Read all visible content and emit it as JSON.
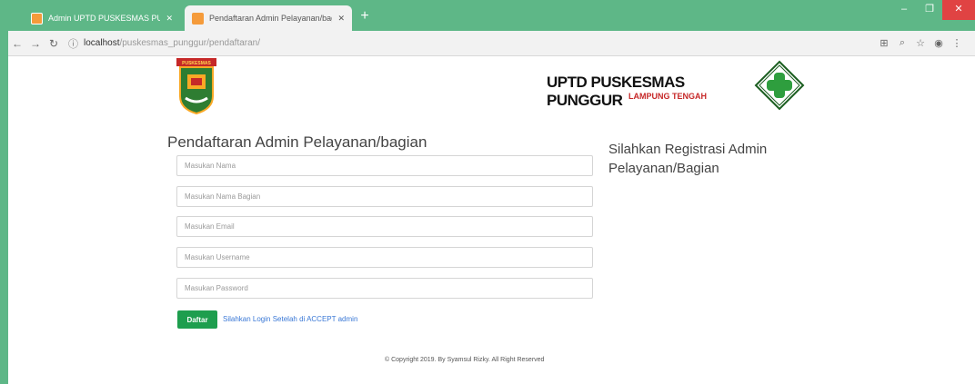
{
  "browser": {
    "tabs": [
      {
        "title": "Admin UPTD PUSKESMAS PUNGGUR",
        "active": false
      },
      {
        "title": "Pendaftaran Admin Pelayanan/bagian",
        "active": true
      }
    ],
    "url_host": "localhost",
    "url_path": "/puskesmas_punggur/pendaftaran/",
    "new_tab_icon": "plus-icon",
    "window_buttons": [
      "minimize-icon",
      "maximize-icon",
      "close-icon"
    ]
  },
  "header": {
    "brand_title": "UPTD PUSKESMAS PUNGGUR",
    "brand_subtitle": "LAMPUNG TENGAH",
    "left_logo_text": "PUSKESMAS"
  },
  "form": {
    "title": "Pendaftaran Admin Pelayanan/bagian",
    "fields": [
      {
        "placeholder": "Masukan Nama",
        "value": ""
      },
      {
        "placeholder": "Masukan Nama Bagian",
        "value": ""
      },
      {
        "placeholder": "Masukan Email",
        "value": ""
      },
      {
        "placeholder": "Masukan Username",
        "value": ""
      },
      {
        "placeholder": "Masukan Password",
        "value": ""
      }
    ],
    "submit_label": "Daftar",
    "login_link": "Silahkan Login Setelah di ACCEPT admin"
  },
  "side_text": "Silahkan Registrasi Admin Pelayanan/Bagian",
  "footer": "© Copyright 2019. By Syamsul Rizky. All Right Reserved",
  "colors": {
    "chrome_green": "#5eb787",
    "button_green": "#1e9e4e",
    "link_blue": "#3a78d6",
    "brand_red": "#c62828"
  }
}
